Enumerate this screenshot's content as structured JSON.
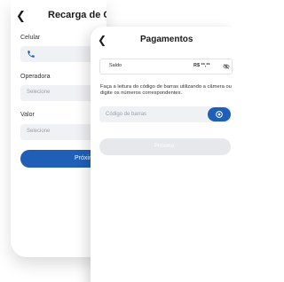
{
  "back_screen": {
    "title": "Recarga de Celular",
    "fields": {
      "celular_label": "Celular",
      "operadora_label": "Operadora",
      "operadora_placeholder": "Selecione",
      "valor_label": "Valor",
      "valor_placeholder": "Selecione"
    },
    "next_button": "Próxim"
  },
  "front_screen": {
    "title": "Pagamentos",
    "balance": {
      "label": "Saldo",
      "value": "R$ **,**"
    },
    "instructions": "Faça a leitura do código de barras utilizando a câmera ou digite os números correspondentes.",
    "barcode_input": {
      "placeholder": "Código de barras"
    },
    "next_button": "Próximo"
  },
  "colors": {
    "accent": "#1f5fb8",
    "field_bg": "#f0f1f4",
    "disabled_button": "#e6e8ec"
  }
}
